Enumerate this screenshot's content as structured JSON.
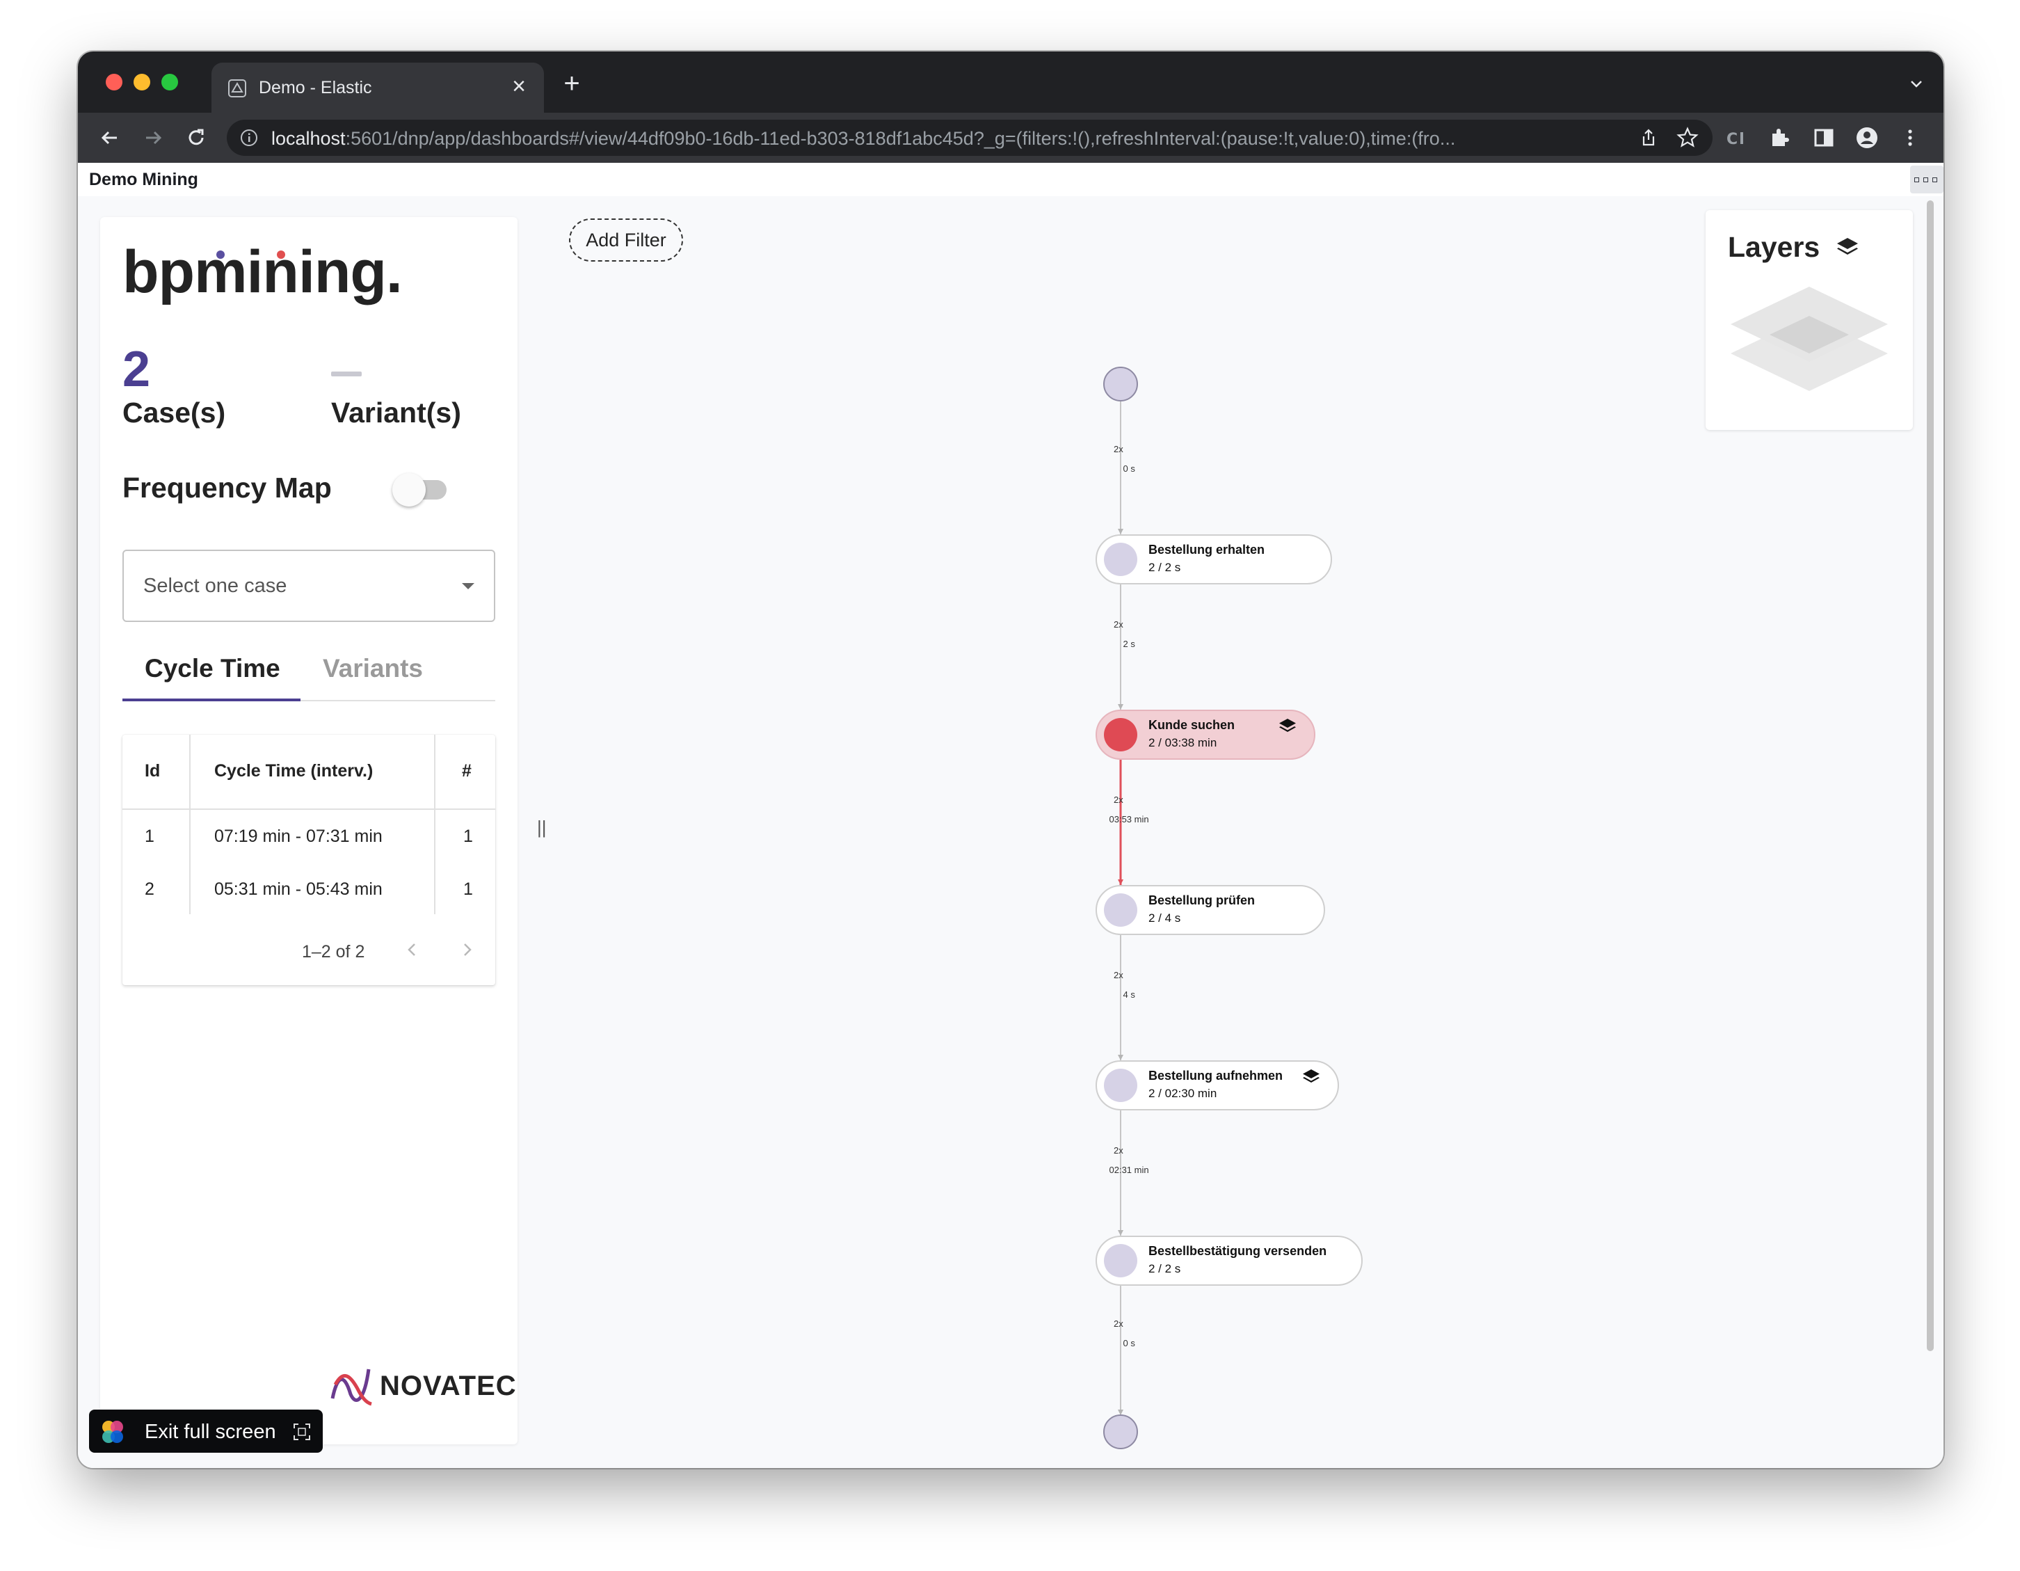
{
  "browser": {
    "tab_title": "Demo - Elastic",
    "url_host": "localhost",
    "url_rest": ":5601/dnp/app/dashboards#/view/44df09b0-16db-11ed-b303-818df1abc45d?_g=(filters:!(),refreshInterval:(pause:!t,value:0),time:(fro..."
  },
  "app": {
    "title": "Demo Mining"
  },
  "panel": {
    "brand": "bpmining.",
    "cases_count": "2",
    "cases_label": "Case(s)",
    "variants_label": "Variant(s)",
    "frequency_map_label": "Frequency Map",
    "frequency_map_on": false,
    "select_placeholder": "Select one case",
    "tabs": [
      "Cycle Time",
      "Variants"
    ],
    "active_tab": "Cycle Time",
    "table": {
      "headers": [
        "Id",
        "Cycle Time (interv.)",
        "#"
      ],
      "rows": [
        {
          "id": "1",
          "cycle": "07:19 min - 07:31 min",
          "count": "1"
        },
        {
          "id": "2",
          "cycle": "05:31 min - 05:43 min",
          "count": "1"
        }
      ],
      "pagination": "1–2 of 2"
    },
    "partner_logo": "NOVATEC",
    "exit_fullscreen": "Exit full screen"
  },
  "canvas": {
    "add_filter": "Add Filter",
    "layers_title": "Layers",
    "resize_handle": "||"
  },
  "process": {
    "nodes": [
      {
        "name": "Bestellung erhalten",
        "value": "2 / 2 s",
        "highlight": false,
        "layer_icon": false
      },
      {
        "name": "Kunde suchen",
        "value": "2 / 03:38 min",
        "highlight": true,
        "layer_icon": true
      },
      {
        "name": "Bestellung prüfen",
        "value": "2 / 4 s",
        "highlight": false,
        "layer_icon": false
      },
      {
        "name": "Bestellung aufnehmen",
        "value": "2 / 02:30 min",
        "highlight": false,
        "layer_icon": true
      },
      {
        "name": "Bestellbestätigung versenden",
        "value": "2 / 2 s",
        "highlight": false,
        "layer_icon": false
      }
    ],
    "edges": [
      {
        "count": "2x",
        "time": "0 s",
        "highlight": false
      },
      {
        "count": "2x",
        "time": "2 s",
        "highlight": false
      },
      {
        "count": "2x",
        "time": "03:53 min",
        "highlight": true
      },
      {
        "count": "2x",
        "time": "4 s",
        "highlight": false
      },
      {
        "count": "2x",
        "time": "02:31 min",
        "highlight": false
      },
      {
        "count": "2x",
        "time": "0 s",
        "highlight": false
      }
    ]
  },
  "colors": {
    "accent": "#4b3f91",
    "hot_node_fill": "#f2cfd4",
    "hot_node_circle": "#df4a54",
    "hot_edge": "#e0505a",
    "node_circle": "#d6d2e6"
  }
}
